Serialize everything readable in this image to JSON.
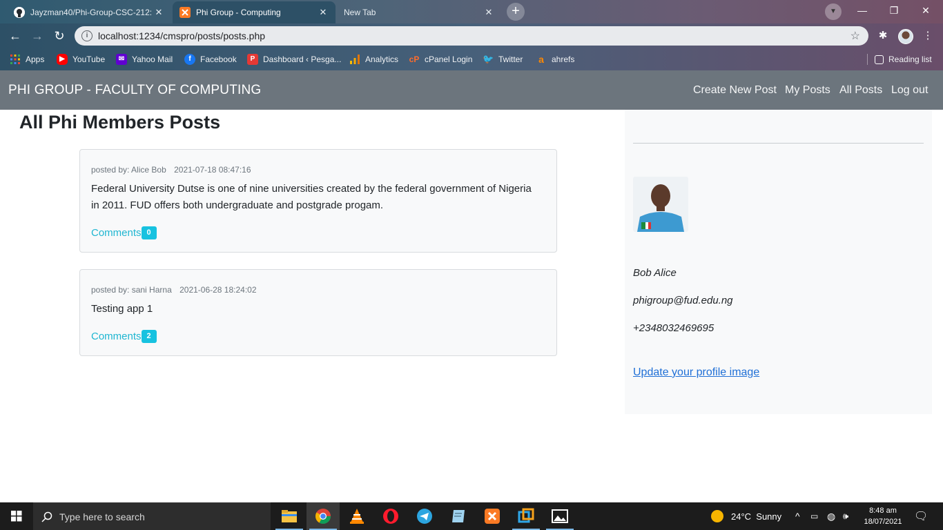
{
  "browser": {
    "tabs": [
      {
        "title": "Jayzman40/Phi-Group-CSC-212:",
        "active": false
      },
      {
        "title": "Phi Group - Computing",
        "active": true
      },
      {
        "title": "New Tab",
        "active": false
      }
    ],
    "url": "localhost:1234/cmspro/posts/posts.php",
    "bookmarks": [
      "Apps",
      "YouTube",
      "Yahoo Mail",
      "Facebook",
      "Dashboard ‹ Pesga...",
      "Analytics",
      "cPanel Login",
      "Twitter",
      "ahrefs"
    ],
    "reading_list": "Reading list"
  },
  "site": {
    "brand": "PHI GROUP - FACULTY OF COMPUTING",
    "nav": [
      "Create New Post",
      "My Posts",
      "All Posts",
      "Log out"
    ]
  },
  "page": {
    "title": "All Phi Members Posts",
    "posts": [
      {
        "author_label": "posted by: Alice Bob",
        "date": "2021-07-18 08:47:16",
        "body": "Federal University Dutse is one of nine universities created by the federal government of Nigeria in 2011. FUD offers both undergraduate and postgrade progam.",
        "comments_label": "Comments",
        "comments_count": "0"
      },
      {
        "author_label": "posted by: sani Harna",
        "date": "2021-06-28 18:24:02",
        "body": "Testing app 1",
        "comments_label": "Comments",
        "comments_count": "2"
      }
    ]
  },
  "sidebar": {
    "name": "Bob Alice",
    "email": "phigroup@fud.edu.ng",
    "phone": "+2348032469695",
    "update_link": "Update your profile image"
  },
  "taskbar": {
    "search_placeholder": "Type here to search",
    "weather": "24°C  Sunny",
    "time": "8:48 am",
    "date": "18/07/2021"
  },
  "colors": {
    "navbar": "#6c757d",
    "accent_info": "#17a2b8",
    "link": "#1f6fd6"
  }
}
